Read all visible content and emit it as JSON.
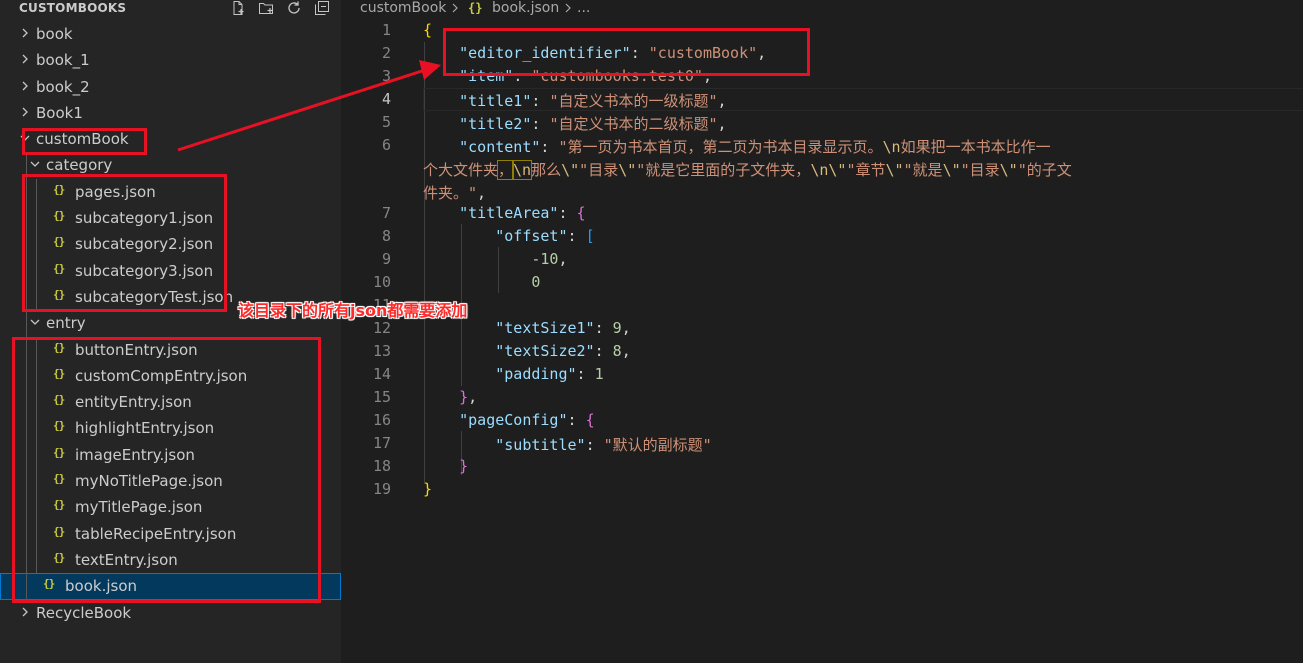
{
  "explorer": {
    "title": "CUSTOMBOOKS",
    "actions": [
      "new-file-icon",
      "new-folder-icon",
      "refresh-icon",
      "collapse-all-icon"
    ],
    "tree": [
      {
        "label": "book",
        "type": "folder",
        "expanded": false,
        "depth": 0
      },
      {
        "label": "book_1",
        "type": "folder",
        "expanded": false,
        "depth": 0
      },
      {
        "label": "book_2",
        "type": "folder",
        "expanded": false,
        "depth": 0
      },
      {
        "label": "Book1",
        "type": "folder",
        "expanded": false,
        "depth": 0
      },
      {
        "label": "customBook",
        "type": "folder",
        "expanded": true,
        "depth": 0
      },
      {
        "label": "category",
        "type": "folder",
        "expanded": true,
        "depth": 1
      },
      {
        "label": "pages.json",
        "type": "json",
        "depth": 2
      },
      {
        "label": "subcategory1.json",
        "type": "json",
        "depth": 2
      },
      {
        "label": "subcategory2.json",
        "type": "json",
        "depth": 2
      },
      {
        "label": "subcategory3.json",
        "type": "json",
        "depth": 2
      },
      {
        "label": "subcategoryTest.json",
        "type": "json",
        "depth": 2
      },
      {
        "label": "entry",
        "type": "folder",
        "expanded": true,
        "depth": 1
      },
      {
        "label": "buttonEntry.json",
        "type": "json",
        "depth": 2
      },
      {
        "label": "customCompEntry.json",
        "type": "json",
        "depth": 2
      },
      {
        "label": "entityEntry.json",
        "type": "json",
        "depth": 2
      },
      {
        "label": "highlightEntry.json",
        "type": "json",
        "depth": 2
      },
      {
        "label": "imageEntry.json",
        "type": "json",
        "depth": 2
      },
      {
        "label": "myNoTitlePage.json",
        "type": "json",
        "depth": 2
      },
      {
        "label": "myTitlePage.json",
        "type": "json",
        "depth": 2
      },
      {
        "label": "tableRecipeEntry.json",
        "type": "json",
        "depth": 2
      },
      {
        "label": "textEntry.json",
        "type": "json",
        "depth": 2
      },
      {
        "label": "book.json",
        "type": "json",
        "depth": 1,
        "selected": true
      },
      {
        "label": "RecycleBook",
        "type": "folder",
        "expanded": false,
        "depth": 0
      }
    ],
    "json_icon": "{}"
  },
  "breadcrumb": {
    "folder": "customBook",
    "file_icon": "{}",
    "file": "book.json",
    "ellipsis": "..."
  },
  "editor": {
    "active_line": 4,
    "line_numbers": [
      "1",
      "2",
      "3",
      "4",
      "5",
      "6",
      "7",
      "8",
      "9",
      "10",
      "11",
      "12",
      "13",
      "14",
      "15",
      "16",
      "17",
      "18",
      "19"
    ],
    "code": {
      "l1_open": "{",
      "k_editor_identifier": "\"editor_identifier\"",
      "v_editor_identifier": "\"customBook\"",
      "k_item": "\"item\"",
      "v_item": "\"custombooks:test0\"",
      "k_title1": "\"title1\"",
      "v_title1": "\"自定义书本的一级标题\"",
      "k_title2": "\"title2\"",
      "v_title2": "\"自定义书本的二级标题\"",
      "k_content": "\"content\"",
      "v_content_a": "\"第一页为书本首页，第二页为书本目录显示页。",
      "v_content_b": "如果把一本书本比作一",
      "v_content_c": "个大文件夹",
      "v_content_c2": "，",
      "v_content_d": "那么",
      "v_content_e": "\"目录",
      "v_content_f": "\"就是它里面的子文件夹，",
      "v_content_g": "\"章节",
      "v_content_h": "\"就是",
      "v_content_i": "\"目录",
      "v_content_j": "\"的子文",
      "v_content_k": "件夹。\"",
      "esc_n": "\\n",
      "esc_q": "\\\"",
      "k_titleArea": "\"titleArea\"",
      "k_offset": "\"offset\"",
      "v_offset_0": "-10",
      "v_offset_1": "0",
      "k_textSize1": "\"textSize1\"",
      "v_textSize1": "9",
      "k_textSize2": "\"textSize2\"",
      "v_textSize2": "8",
      "k_padding": "\"padding\"",
      "v_padding": "1",
      "k_pageConfig": "\"pageConfig\"",
      "k_subtitle": "\"subtitle\"",
      "v_subtitle": "\"默认的副标题\"",
      "l19_close": "}"
    }
  },
  "annotation": {
    "note": "该目录下的所有json都需要添加",
    "color": "#e81123"
  }
}
